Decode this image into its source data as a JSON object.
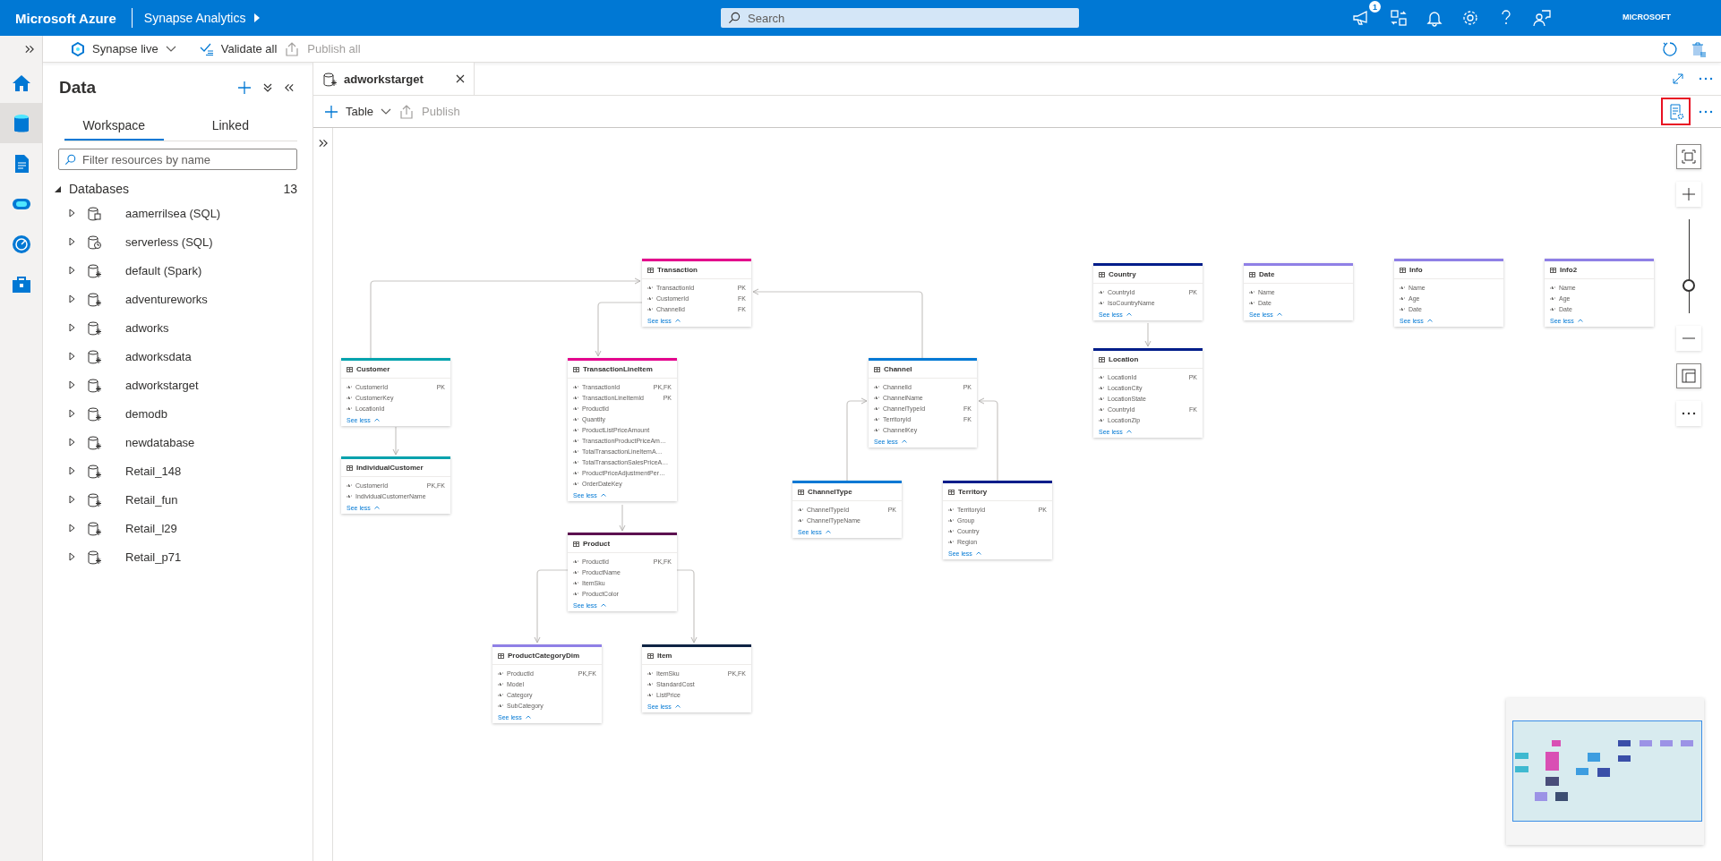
{
  "top_bar": {
    "brand": "Microsoft Azure",
    "product": "Synapse Analytics",
    "search": {
      "placeholder": "Search"
    },
    "feedback_badge": "1",
    "account": "MICROSOFT"
  },
  "command_bar": {
    "workspace": "Synapse live",
    "validate": {
      "label": "Validate all",
      "disabled": false
    },
    "publish": {
      "label": "Publish all",
      "disabled": true
    }
  },
  "rail": {
    "items": [
      {
        "kind": "home",
        "selected": false
      },
      {
        "kind": "data",
        "selected": true
      },
      {
        "kind": "develop",
        "selected": false
      },
      {
        "kind": "integrate",
        "selected": false
      },
      {
        "kind": "monitor",
        "selected": false
      },
      {
        "kind": "manage",
        "selected": false
      }
    ]
  },
  "data_panel": {
    "title": "Data",
    "tabs": [
      {
        "label": "Workspace",
        "selected": true
      },
      {
        "label": "Linked",
        "selected": false
      }
    ],
    "filter": {
      "placeholder": "Filter resources by name"
    },
    "tree": {
      "label": "Databases",
      "count": "13",
      "expanded": true,
      "children": [
        {
          "label": "aamerrilsea (SQL)",
          "kind": "sql",
          "expanded": false
        },
        {
          "label": "serverless (SQL)",
          "kind": "serverless",
          "expanded": false
        },
        {
          "label": "default (Spark)",
          "kind": "lake",
          "expanded": false
        },
        {
          "label": "adventureworks",
          "kind": "lake",
          "expanded": false
        },
        {
          "label": "adworks",
          "kind": "lake",
          "expanded": false
        },
        {
          "label": "adworksdata",
          "kind": "lake",
          "expanded": false
        },
        {
          "label": "adworkstarget",
          "kind": "lake",
          "expanded": false
        },
        {
          "label": "demodb",
          "kind": "lake",
          "expanded": false
        },
        {
          "label": "newdatabase",
          "kind": "lake",
          "expanded": false
        },
        {
          "label": "Retail_148",
          "kind": "lake",
          "expanded": false
        },
        {
          "label": "Retail_fun",
          "kind": "lake",
          "expanded": false
        },
        {
          "label": "Retail_l29",
          "kind": "lake",
          "expanded": false
        },
        {
          "label": "Retail_p71",
          "kind": "lake",
          "expanded": false
        }
      ]
    }
  },
  "editor": {
    "tab": {
      "label": "adworkstarget"
    },
    "toolbar": {
      "add": "Table",
      "publish": {
        "label": "Publish",
        "disabled": true
      },
      "properties": {
        "highlighted": true
      }
    },
    "diagram": {
      "tables": [
        {
          "name": "Transaction",
          "color": "#e3008c",
          "columns": [
            {
              "name": "TransactionId",
              "key": "PK"
            },
            {
              "name": "CustomerId",
              "key": "FK"
            },
            {
              "name": "ChannelId",
              "key": "FK"
            }
          ],
          "footer": "See less"
        },
        {
          "name": "Customer",
          "color": "#00a2ad",
          "columns": [
            {
              "name": "CustomerId",
              "key": "PK"
            },
            {
              "name": "CustomerKey"
            },
            {
              "name": "LocationId"
            }
          ],
          "footer": "See less"
        },
        {
          "name": "IndividualCustomer",
          "color": "#00a2ad",
          "columns": [
            {
              "name": "CustomerId",
              "key": "PK,FK"
            },
            {
              "name": "IndividualCustomerName"
            }
          ],
          "footer": "See less"
        },
        {
          "name": "TransactionLineItem",
          "color": "#e3008c",
          "columns": [
            {
              "name": "TransactionId",
              "key": "PK,FK"
            },
            {
              "name": "TransactionLineItemId",
              "key": "PK"
            },
            {
              "name": "ProductId"
            },
            {
              "name": "Quantity"
            },
            {
              "name": "ProductListPriceAmount"
            },
            {
              "name": "TransactionProductPriceAm…"
            },
            {
              "name": "TotalTransactionLineItemA…"
            },
            {
              "name": "TotalTransactionSalesPriceA…"
            },
            {
              "name": "ProductPriceAdjustmentPer…"
            },
            {
              "name": "OrderDateKey"
            }
          ],
          "footer": "See less"
        },
        {
          "name": "Product",
          "color": "#5c1150",
          "columns": [
            {
              "name": "ProductId",
              "key": "PK,FK"
            },
            {
              "name": "ProductName"
            },
            {
              "name": "ItemSku"
            },
            {
              "name": "ProductColor"
            }
          ],
          "footer": "See less"
        },
        {
          "name": "ProductCategoryDim",
          "color": "#8f80e6",
          "columns": [
            {
              "name": "ProductId",
              "key": "PK,FK"
            },
            {
              "name": "Model"
            },
            {
              "name": "Category"
            },
            {
              "name": "SubCategory"
            }
          ],
          "footer": "See less"
        },
        {
          "name": "Item",
          "color": "#0f2444",
          "columns": [
            {
              "name": "ItemSku",
              "key": "PK,FK"
            },
            {
              "name": "StandardCost"
            },
            {
              "name": "ListPrice"
            }
          ],
          "footer": "See less"
        },
        {
          "name": "Channel",
          "color": "#0078d4",
          "columns": [
            {
              "name": "ChannelId",
              "key": "PK"
            },
            {
              "name": "ChannelName"
            },
            {
              "name": "ChannelTypeId",
              "key": "FK"
            },
            {
              "name": "TerritoryId",
              "key": "FK"
            },
            {
              "name": "ChannelKey"
            }
          ],
          "footer": "See less"
        },
        {
          "name": "ChannelType",
          "color": "#0078d4",
          "columns": [
            {
              "name": "ChannelTypeId",
              "key": "PK"
            },
            {
              "name": "ChannelTypeName"
            }
          ],
          "footer": "See less"
        },
        {
          "name": "Territory",
          "color": "#001d8a",
          "columns": [
            {
              "name": "TerritoryId",
              "key": "PK"
            },
            {
              "name": "Group"
            },
            {
              "name": "Country"
            },
            {
              "name": "Region"
            }
          ],
          "footer": "See less"
        },
        {
          "name": "Country",
          "color": "#001d8a",
          "columns": [
            {
              "name": "CountryId",
              "key": "PK"
            },
            {
              "name": "IsoCountryName"
            }
          ],
          "footer": "See less"
        },
        {
          "name": "Location",
          "color": "#001d8a",
          "columns": [
            {
              "name": "LocationId",
              "key": "PK"
            },
            {
              "name": "LocationCity"
            },
            {
              "name": "LocationState"
            },
            {
              "name": "CountryId",
              "key": "FK"
            },
            {
              "name": "LocationZip"
            }
          ],
          "footer": "See less"
        },
        {
          "name": "Date",
          "color": "#8f80e6",
          "columns": [
            {
              "name": "Name"
            },
            {
              "name": "Date"
            }
          ],
          "footer": "See less"
        },
        {
          "name": "Info",
          "color": "#8f80e6",
          "columns": [
            {
              "name": "Name"
            },
            {
              "name": "Age"
            },
            {
              "name": "Date"
            }
          ],
          "footer": "See less"
        },
        {
          "name": "Info2",
          "color": "#8f80e6",
          "columns": [
            {
              "name": "Name"
            },
            {
              "name": "Age"
            },
            {
              "name": "Date"
            }
          ],
          "footer": "See less"
        }
      ]
    },
    "zoom": {
      "level": 0.3
    }
  }
}
